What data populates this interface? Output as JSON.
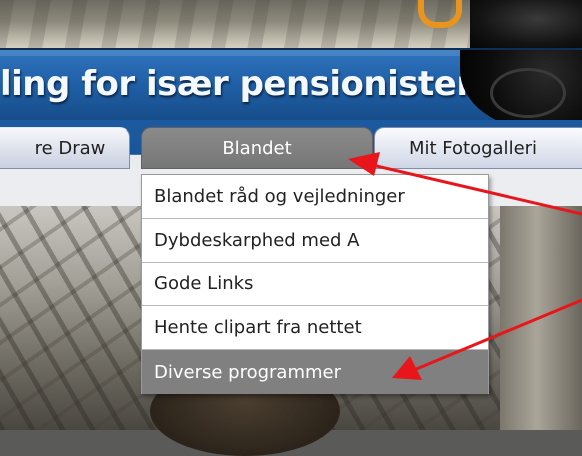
{
  "header": {
    "title": "ling for især pensionister"
  },
  "nav": {
    "tabs": [
      {
        "label": "re Draw"
      },
      {
        "label": "Blandet"
      },
      {
        "label": "Mit Fotogalleri"
      }
    ]
  },
  "dropdown": {
    "items": [
      {
        "label": "Blandet råd og vejledninger"
      },
      {
        "label": "Dybdeskarphed med A"
      },
      {
        "label": "Gode Links"
      },
      {
        "label": "Hente clipart fra nettet"
      },
      {
        "label": "Diverse programmer"
      }
    ],
    "highlighted_index": 4
  },
  "colors": {
    "title_bar": "#1f5fa6",
    "active_tab": "#808080",
    "annotation_arrow": "#e8161b"
  }
}
